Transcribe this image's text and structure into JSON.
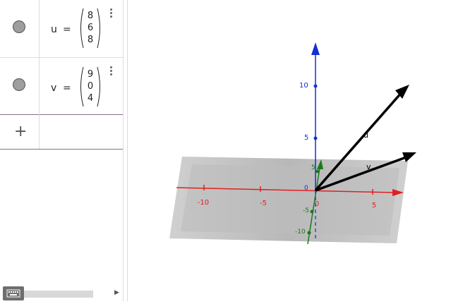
{
  "algebra": {
    "items": [
      {
        "name": "u",
        "equals": "=",
        "components": [
          "8",
          "6",
          "8"
        ]
      },
      {
        "name": "v",
        "equals": "=",
        "components": [
          "9",
          "0",
          "4"
        ]
      }
    ],
    "input_plus": "+"
  },
  "graphics": {
    "axis_labels": {
      "z10": "10",
      "z5": "5",
      "x_neg10": "-10",
      "x_neg5": "-5",
      "x0": "0",
      "x5": "5",
      "y5": "5",
      "y_neg5": "-5",
      "y_neg10": "-10",
      "origin": "0"
    },
    "vector_labels": {
      "u": "u",
      "v": "v"
    },
    "colors": {
      "x_axis": "#e02020",
      "y_axis": "#1a7a1a",
      "z_axis": "#1530d0",
      "plane": "#bdbdbd",
      "vector": "#000000"
    }
  }
}
